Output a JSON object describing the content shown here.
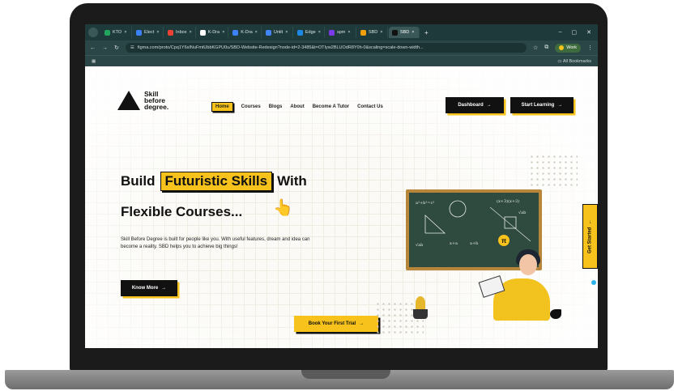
{
  "browser": {
    "tabs": [
      {
        "label": "KTO",
        "color": "#22a45d"
      },
      {
        "label": "Elect",
        "color": "#3b82f6"
      },
      {
        "label": "Inbox",
        "color": "#ea4335"
      },
      {
        "label": "K-Dra",
        "color": "#ffffff"
      },
      {
        "label": "K-Dra",
        "color": "#3b82f6"
      },
      {
        "label": "Untit",
        "color": "#4285f4"
      },
      {
        "label": "Edge",
        "color": "#1e88e5"
      },
      {
        "label": "spm",
        "color": "#7c3aed"
      },
      {
        "label": "SBD",
        "color": "#f59e0b"
      },
      {
        "label": "SBD",
        "color": "#111111",
        "active": true
      }
    ],
    "new_tab": "+",
    "url": "figma.com/proto/Cpq1Y6sINuFmtUbbKGPU0u/SBD-Website-Redesign?node-id=2-3485&t=OTIyw2BLUOdR8Y0h-0&scaling=scale-down-width...",
    "profile": "Work",
    "bookmarks": "All Bookmarks"
  },
  "site": {
    "logo": {
      "line1": "Skill",
      "line2": "before",
      "line3": "degree."
    },
    "nav": [
      "Home",
      "Courses",
      "Blogs",
      "About",
      "Become A Tutor",
      "Contact Us"
    ],
    "dashboard_btn": "Dashboard",
    "start_btn": "Start Learning",
    "arrow": "→",
    "hero": {
      "build": "Build",
      "highlight": "Futuristic Skills",
      "with": "With",
      "line2": "Flexible Courses...",
      "description": "Skill Before Degree is built for people like you. With useful features, dream and idea can become a reality. SBD helps you to achieve big things!"
    },
    "know_more": "Know More",
    "trial": "Book Your First Trial",
    "get_started": "Get Started",
    "board": {
      "f1": "a²+b²=c²",
      "f2": "(x+3)(x+3)",
      "f3": "√ab",
      "f4": "x+a",
      "f5": "√ab",
      "f6": "a+b",
      "pi": "π"
    }
  },
  "colors": {
    "accent": "#f6c21b",
    "dark": "#111111",
    "chrome": "#1f3a3a"
  }
}
